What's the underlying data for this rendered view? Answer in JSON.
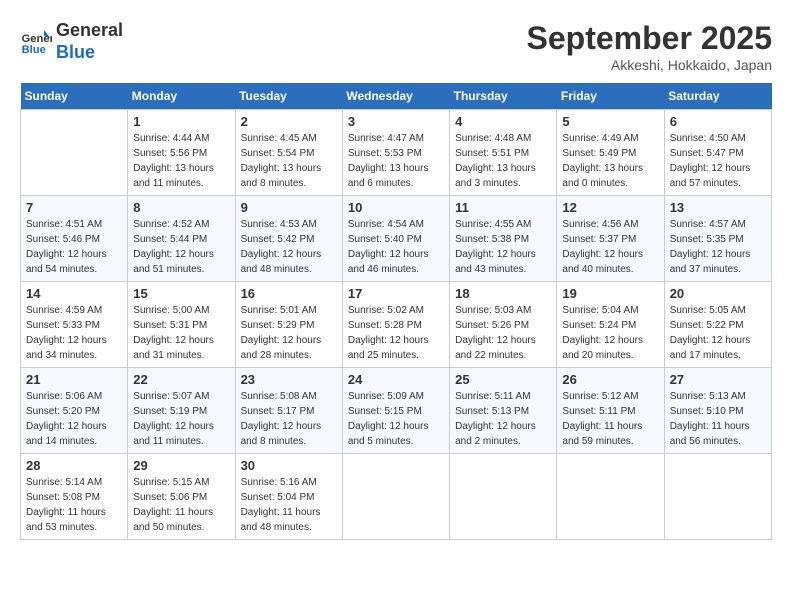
{
  "header": {
    "logo_line1": "General",
    "logo_line2": "Blue",
    "month": "September 2025",
    "location": "Akkeshi, Hokkaido, Japan"
  },
  "days_of_week": [
    "Sunday",
    "Monday",
    "Tuesday",
    "Wednesday",
    "Thursday",
    "Friday",
    "Saturday"
  ],
  "weeks": [
    [
      {
        "num": "",
        "sunrise": "",
        "sunset": "",
        "daylight": ""
      },
      {
        "num": "1",
        "sunrise": "Sunrise: 4:44 AM",
        "sunset": "Sunset: 5:56 PM",
        "daylight": "Daylight: 13 hours and 11 minutes."
      },
      {
        "num": "2",
        "sunrise": "Sunrise: 4:45 AM",
        "sunset": "Sunset: 5:54 PM",
        "daylight": "Daylight: 13 hours and 8 minutes."
      },
      {
        "num": "3",
        "sunrise": "Sunrise: 4:47 AM",
        "sunset": "Sunset: 5:53 PM",
        "daylight": "Daylight: 13 hours and 6 minutes."
      },
      {
        "num": "4",
        "sunrise": "Sunrise: 4:48 AM",
        "sunset": "Sunset: 5:51 PM",
        "daylight": "Daylight: 13 hours and 3 minutes."
      },
      {
        "num": "5",
        "sunrise": "Sunrise: 4:49 AM",
        "sunset": "Sunset: 5:49 PM",
        "daylight": "Daylight: 13 hours and 0 minutes."
      },
      {
        "num": "6",
        "sunrise": "Sunrise: 4:50 AM",
        "sunset": "Sunset: 5:47 PM",
        "daylight": "Daylight: 12 hours and 57 minutes."
      }
    ],
    [
      {
        "num": "7",
        "sunrise": "Sunrise: 4:51 AM",
        "sunset": "Sunset: 5:46 PM",
        "daylight": "Daylight: 12 hours and 54 minutes."
      },
      {
        "num": "8",
        "sunrise": "Sunrise: 4:52 AM",
        "sunset": "Sunset: 5:44 PM",
        "daylight": "Daylight: 12 hours and 51 minutes."
      },
      {
        "num": "9",
        "sunrise": "Sunrise: 4:53 AM",
        "sunset": "Sunset: 5:42 PM",
        "daylight": "Daylight: 12 hours and 48 minutes."
      },
      {
        "num": "10",
        "sunrise": "Sunrise: 4:54 AM",
        "sunset": "Sunset: 5:40 PM",
        "daylight": "Daylight: 12 hours and 46 minutes."
      },
      {
        "num": "11",
        "sunrise": "Sunrise: 4:55 AM",
        "sunset": "Sunset: 5:38 PM",
        "daylight": "Daylight: 12 hours and 43 minutes."
      },
      {
        "num": "12",
        "sunrise": "Sunrise: 4:56 AM",
        "sunset": "Sunset: 5:37 PM",
        "daylight": "Daylight: 12 hours and 40 minutes."
      },
      {
        "num": "13",
        "sunrise": "Sunrise: 4:57 AM",
        "sunset": "Sunset: 5:35 PM",
        "daylight": "Daylight: 12 hours and 37 minutes."
      }
    ],
    [
      {
        "num": "14",
        "sunrise": "Sunrise: 4:59 AM",
        "sunset": "Sunset: 5:33 PM",
        "daylight": "Daylight: 12 hours and 34 minutes."
      },
      {
        "num": "15",
        "sunrise": "Sunrise: 5:00 AM",
        "sunset": "Sunset: 5:31 PM",
        "daylight": "Daylight: 12 hours and 31 minutes."
      },
      {
        "num": "16",
        "sunrise": "Sunrise: 5:01 AM",
        "sunset": "Sunset: 5:29 PM",
        "daylight": "Daylight: 12 hours and 28 minutes."
      },
      {
        "num": "17",
        "sunrise": "Sunrise: 5:02 AM",
        "sunset": "Sunset: 5:28 PM",
        "daylight": "Daylight: 12 hours and 25 minutes."
      },
      {
        "num": "18",
        "sunrise": "Sunrise: 5:03 AM",
        "sunset": "Sunset: 5:26 PM",
        "daylight": "Daylight: 12 hours and 22 minutes."
      },
      {
        "num": "19",
        "sunrise": "Sunrise: 5:04 AM",
        "sunset": "Sunset: 5:24 PM",
        "daylight": "Daylight: 12 hours and 20 minutes."
      },
      {
        "num": "20",
        "sunrise": "Sunrise: 5:05 AM",
        "sunset": "Sunset: 5:22 PM",
        "daylight": "Daylight: 12 hours and 17 minutes."
      }
    ],
    [
      {
        "num": "21",
        "sunrise": "Sunrise: 5:06 AM",
        "sunset": "Sunset: 5:20 PM",
        "daylight": "Daylight: 12 hours and 14 minutes."
      },
      {
        "num": "22",
        "sunrise": "Sunrise: 5:07 AM",
        "sunset": "Sunset: 5:19 PM",
        "daylight": "Daylight: 12 hours and 11 minutes."
      },
      {
        "num": "23",
        "sunrise": "Sunrise: 5:08 AM",
        "sunset": "Sunset: 5:17 PM",
        "daylight": "Daylight: 12 hours and 8 minutes."
      },
      {
        "num": "24",
        "sunrise": "Sunrise: 5:09 AM",
        "sunset": "Sunset: 5:15 PM",
        "daylight": "Daylight: 12 hours and 5 minutes."
      },
      {
        "num": "25",
        "sunrise": "Sunrise: 5:11 AM",
        "sunset": "Sunset: 5:13 PM",
        "daylight": "Daylight: 12 hours and 2 minutes."
      },
      {
        "num": "26",
        "sunrise": "Sunrise: 5:12 AM",
        "sunset": "Sunset: 5:11 PM",
        "daylight": "Daylight: 11 hours and 59 minutes."
      },
      {
        "num": "27",
        "sunrise": "Sunrise: 5:13 AM",
        "sunset": "Sunset: 5:10 PM",
        "daylight": "Daylight: 11 hours and 56 minutes."
      }
    ],
    [
      {
        "num": "28",
        "sunrise": "Sunrise: 5:14 AM",
        "sunset": "Sunset: 5:08 PM",
        "daylight": "Daylight: 11 hours and 53 minutes."
      },
      {
        "num": "29",
        "sunrise": "Sunrise: 5:15 AM",
        "sunset": "Sunset: 5:06 PM",
        "daylight": "Daylight: 11 hours and 50 minutes."
      },
      {
        "num": "30",
        "sunrise": "Sunrise: 5:16 AM",
        "sunset": "Sunset: 5:04 PM",
        "daylight": "Daylight: 11 hours and 48 minutes."
      },
      {
        "num": "",
        "sunrise": "",
        "sunset": "",
        "daylight": ""
      },
      {
        "num": "",
        "sunrise": "",
        "sunset": "",
        "daylight": ""
      },
      {
        "num": "",
        "sunrise": "",
        "sunset": "",
        "daylight": ""
      },
      {
        "num": "",
        "sunrise": "",
        "sunset": "",
        "daylight": ""
      }
    ]
  ]
}
